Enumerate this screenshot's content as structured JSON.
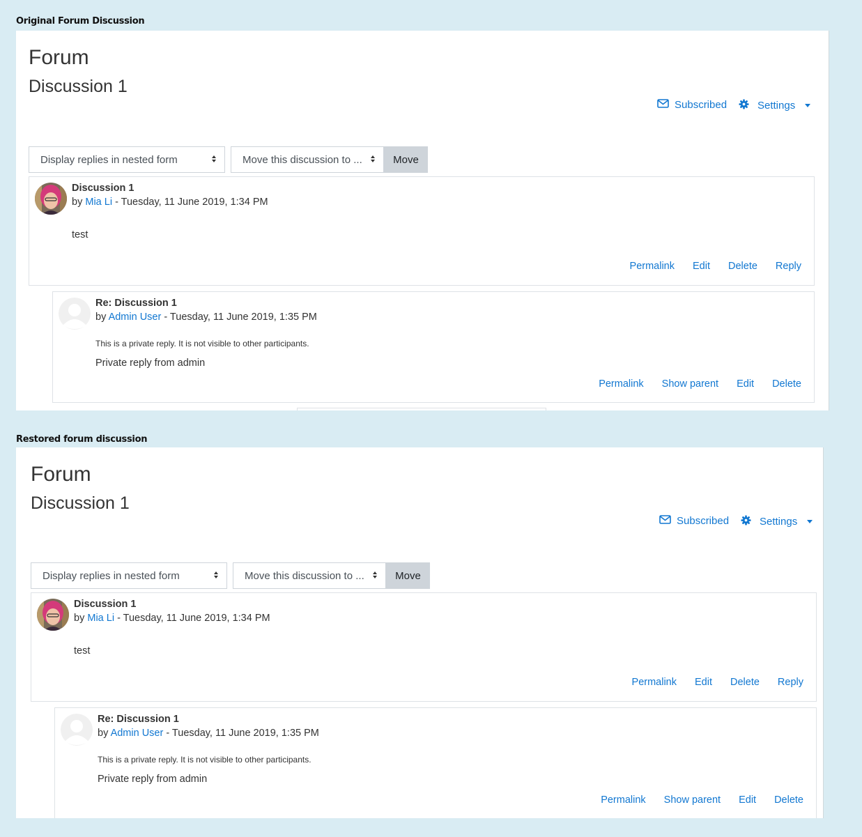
{
  "sections": [
    {
      "caption": "Original Forum Discussion",
      "page_title": "Forum",
      "discussion_title": "Discussion 1",
      "subscribed_label": "Subscribed",
      "settings_label": "Settings",
      "display_mode": "Display replies in nested form",
      "move_select": "Move this discussion to ...",
      "move_button": "Move",
      "post": {
        "subject": "Discussion 1",
        "by": "by",
        "author": "Mia Li",
        "date": " - Tuesday, 11 June 2019, 1:34 PM",
        "text": "test",
        "actions": [
          "Permalink",
          "Edit",
          "Delete",
          "Reply"
        ]
      },
      "reply": {
        "subject": "Re: Discussion 1",
        "by": "by",
        "author": "Admin User",
        "date": " - Tuesday, 11 June 2019, 1:35 PM",
        "private_note": "This is a private reply. It is not visible to other participants.",
        "text": "Private reply from admin",
        "actions": [
          "Permalink",
          "Show parent",
          "Edit",
          "Delete"
        ]
      }
    },
    {
      "caption": "Restored forum discussion",
      "page_title": "Forum",
      "discussion_title": "Discussion 1",
      "subscribed_label": "Subscribed",
      "settings_label": "Settings",
      "display_mode": "Display replies in nested form",
      "move_select": "Move this discussion to ...",
      "move_button": "Move",
      "post": {
        "subject": "Discussion 1",
        "by": "by",
        "author": "Mia Li",
        "date": " - Tuesday, 11 June 2019, 1:34 PM",
        "text": "test",
        "actions": [
          "Permalink",
          "Edit",
          "Delete",
          "Reply"
        ]
      },
      "reply": {
        "subject": "Re: Discussion 1",
        "by": "by",
        "author": "Admin User",
        "date": " - Tuesday, 11 June 2019, 1:35 PM",
        "private_note": "This is a private reply. It is not visible to other participants.",
        "text": "Private reply from admin",
        "actions": [
          "Permalink",
          "Show parent",
          "Edit",
          "Delete"
        ]
      }
    }
  ],
  "colors": {
    "link": "#1177d1",
    "background": "#d9ecf3",
    "button": "#ced4da"
  },
  "icons": {
    "subscribed": "envelope-icon",
    "settings": "gear-icon"
  }
}
